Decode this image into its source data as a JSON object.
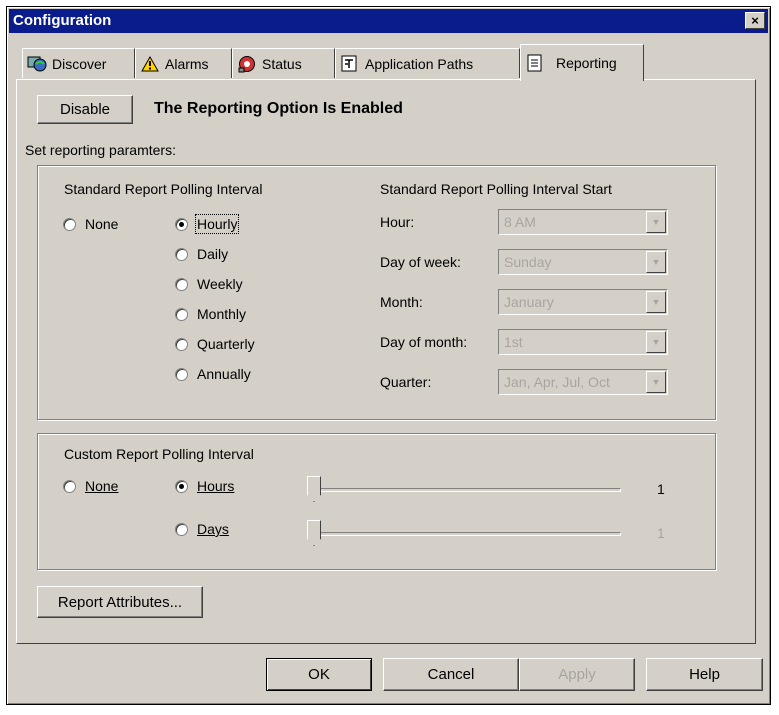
{
  "window": {
    "title": "Configuration",
    "close_label": "×"
  },
  "tabs": [
    {
      "label": "Discover",
      "icon": "discover-icon"
    },
    {
      "label": "Alarms",
      "icon": "alarm-icon"
    },
    {
      "label": "Status",
      "icon": "status-icon"
    },
    {
      "label": "Application Paths",
      "icon": "application-paths-icon"
    },
    {
      "label": "Reporting",
      "icon": "reporting-icon",
      "active": true
    }
  ],
  "reporting": {
    "disable_label": "Disable",
    "status_text": "The Reporting Option Is Enabled",
    "set_params_label": "Set reporting paramters:"
  },
  "standard": {
    "group_label": "Standard Report Polling Interval",
    "none_label": "None",
    "options": [
      "Hourly",
      "Daily",
      "Weekly",
      "Monthly",
      "Quarterly",
      "Annually"
    ],
    "selected": "Hourly"
  },
  "start": {
    "group_label": "Standard Report Polling Interval Start",
    "fields": [
      {
        "label": "Hour:",
        "value": "8 AM"
      },
      {
        "label": "Day of week:",
        "value": "Sunday"
      },
      {
        "label": "Month:",
        "value": "January"
      },
      {
        "label": "Day of month:",
        "value": "1st"
      },
      {
        "label": "Quarter:",
        "value": "Jan, Apr, Jul, Oct"
      }
    ]
  },
  "custom": {
    "group_label": "Custom Report Polling Interval",
    "none_label": "None",
    "hours_label": "Hours",
    "days_label": "Days",
    "hours_value": "1",
    "days_value": "1",
    "selected": "Hours"
  },
  "report_attributes_label": "Report Attributes...",
  "footer": {
    "ok": "OK",
    "cancel": "Cancel",
    "apply": "Apply",
    "help": "Help"
  },
  "colors": {
    "titlebar": "#0a1c8c",
    "face": "#d4d0c8",
    "disabled_text": "#a8a4a0"
  }
}
